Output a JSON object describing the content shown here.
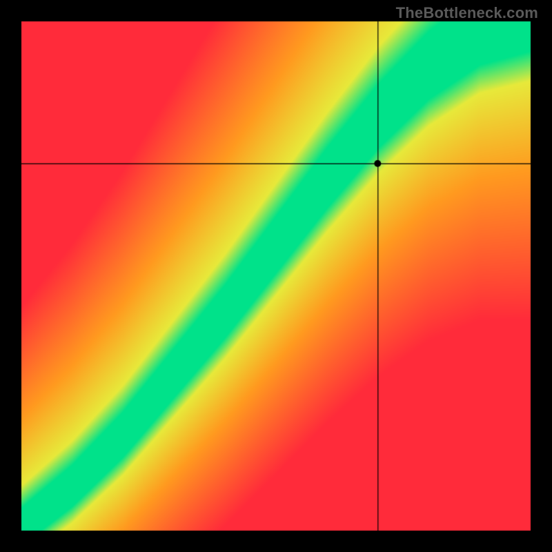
{
  "watermark": "TheBottleneck.com",
  "chart_data": {
    "type": "heatmap",
    "title": "",
    "xlabel": "",
    "ylabel": "",
    "xlim": [
      0,
      1
    ],
    "ylim": [
      0,
      1
    ],
    "crosshair": {
      "x": 0.7,
      "y": 0.72
    },
    "marker": {
      "x": 0.7,
      "y": 0.72,
      "radius": 5
    },
    "ridge": {
      "description": "Green optimal band running diagonally; below it red (GPU-bound), above/right yellow-orange falling to red (CPU-bound).",
      "points": [
        {
          "x": 0.0,
          "y": 0.0
        },
        {
          "x": 0.1,
          "y": 0.08
        },
        {
          "x": 0.2,
          "y": 0.18
        },
        {
          "x": 0.3,
          "y": 0.3
        },
        {
          "x": 0.4,
          "y": 0.42
        },
        {
          "x": 0.5,
          "y": 0.55
        },
        {
          "x": 0.6,
          "y": 0.68
        },
        {
          "x": 0.7,
          "y": 0.8
        },
        {
          "x": 0.8,
          "y": 0.9
        },
        {
          "x": 0.9,
          "y": 0.97
        },
        {
          "x": 1.0,
          "y": 1.0
        }
      ],
      "half_width": 0.055
    },
    "colors": {
      "optimal": "#00e28a",
      "near": "#e7e93a",
      "warm": "#ff9a1f",
      "hot": "#ff2b3a"
    },
    "resolution": 220
  }
}
